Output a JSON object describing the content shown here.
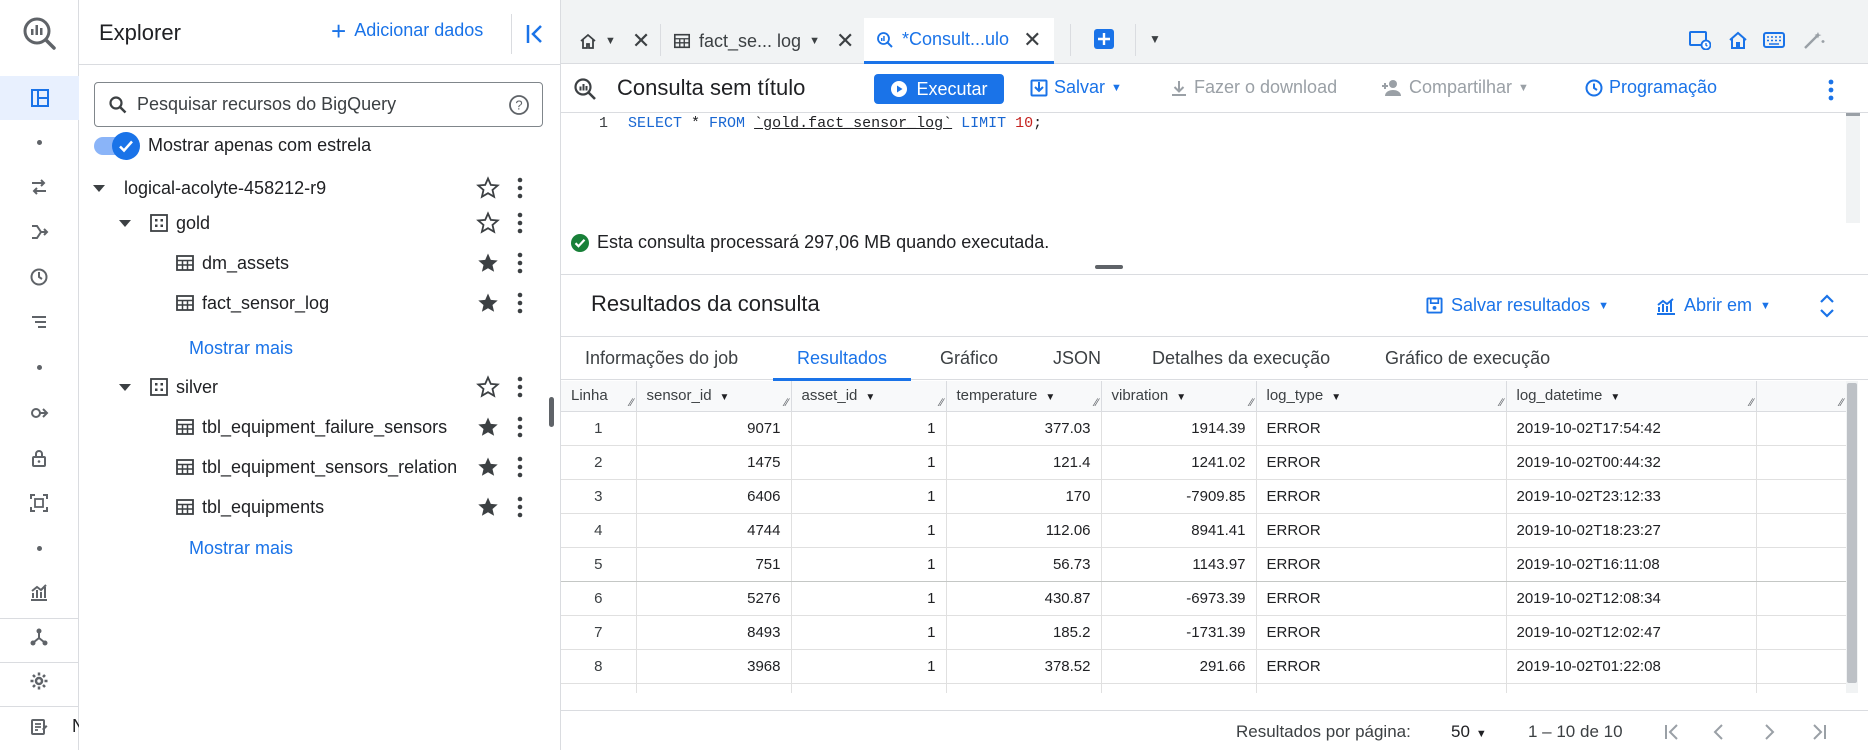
{
  "colors": {
    "accent": "#1a73e8",
    "success": "#188038",
    "text": "#202124",
    "muted": "#5f6368"
  },
  "rail": {
    "icons": [
      "bigquery-logo-icon",
      "dashboard-icon",
      "transfer-icon",
      "pipeline-icon",
      "history-icon",
      "list-icon",
      "target-icon",
      "lock-icon",
      "scan-icon",
      "chart-icon",
      "network-icon",
      "gear-icon",
      "notes-icon"
    ],
    "truncated": "N"
  },
  "explorer": {
    "title": "Explorer",
    "add_data": "Adicionar dados",
    "search_placeholder": "Pesquisar recursos do BigQuery",
    "starred_only_label": "Mostrar apenas com estrela",
    "project": "logical-acolyte-458212-r9",
    "datasets": [
      {
        "name": "gold",
        "tables": [
          "dm_assets",
          "fact_sensor_log"
        ],
        "show_more": "Mostrar mais"
      },
      {
        "name": "silver",
        "tables": [
          "tbl_equipment_failure_sensors",
          "tbl_equipment_sensors_relation",
          "tbl_equipments"
        ],
        "show_more": "Mostrar mais"
      }
    ]
  },
  "tabs": [
    {
      "label": ""
    },
    {
      "label": "fact_se... log"
    },
    {
      "label": "*Consult...ulo"
    }
  ],
  "toolbar": {
    "query_title": "Consulta sem título",
    "run": "Executar",
    "save": "Salvar",
    "download": "Fazer o download",
    "share": "Compartilhar",
    "schedule": "Programação"
  },
  "editor": {
    "line": "1",
    "kw_select": "SELECT",
    "star_from": " * ",
    "kw_from": "FROM",
    "table_ref": "`gold.fact_sensor_log`",
    "kw_limit": "LIMIT",
    "limit_value": "10",
    "semicolon": ";"
  },
  "validation": "Esta consulta processará 297,06 MB quando executada.",
  "results": {
    "title": "Resultados da consulta",
    "save_results": "Salvar resultados",
    "open_in": "Abrir em",
    "tabs": [
      "Informações do job",
      "Resultados",
      "Gráfico",
      "JSON",
      "Detalhes da execução",
      "Gráfico de execução"
    ],
    "columns": [
      "Linha",
      "sensor_id",
      "asset_id",
      "temperature",
      "vibration",
      "log_type",
      "log_datetime"
    ],
    "rows": [
      [
        "1",
        "9071",
        "1",
        "377.03",
        "1914.39",
        "ERROR",
        "2019-10-02T17:54:42"
      ],
      [
        "2",
        "1475",
        "1",
        "121.4",
        "1241.02",
        "ERROR",
        "2019-10-02T00:44:32"
      ],
      [
        "3",
        "6406",
        "1",
        "170",
        "-7909.85",
        "ERROR",
        "2019-10-02T23:12:33"
      ],
      [
        "4",
        "4744",
        "1",
        "112.06",
        "8941.41",
        "ERROR",
        "2019-10-02T18:23:27"
      ],
      [
        "5",
        "751",
        "1",
        "56.73",
        "1143.97",
        "ERROR",
        "2019-10-02T16:11:08"
      ],
      [
        "6",
        "5276",
        "1",
        "430.87",
        "-6973.39",
        "ERROR",
        "2019-10-02T12:08:34"
      ],
      [
        "7",
        "8493",
        "1",
        "185.2",
        "-1731.39",
        "ERROR",
        "2019-10-02T12:02:47"
      ],
      [
        "8",
        "3968",
        "1",
        "378.52",
        "291.66",
        "ERROR",
        "2019-10-02T01:22:08"
      ]
    ]
  },
  "pager": {
    "per_page_label": "Resultados por página:",
    "per_page_value": "50",
    "range": "1 – 10 de 10"
  }
}
